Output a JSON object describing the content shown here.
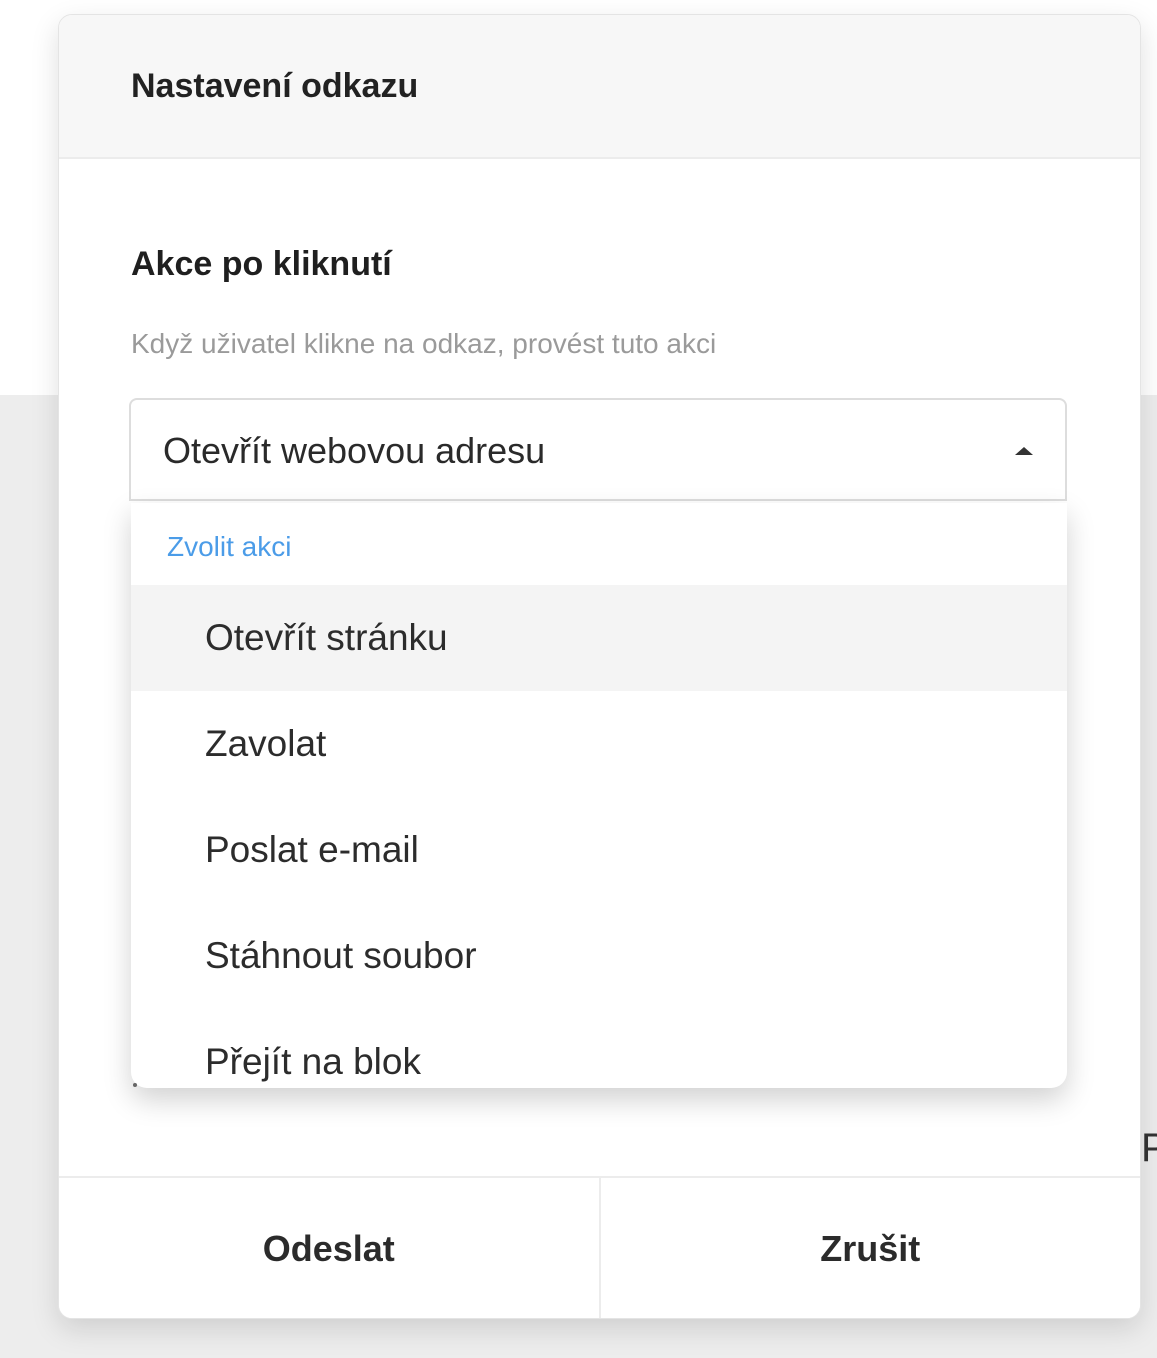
{
  "modal": {
    "title": "Nastavení odkazu",
    "section_label": "Akce po kliknutí",
    "section_help": "Když uživatel klikne na odkaz, provést tuto akci"
  },
  "select": {
    "selected_value": "Otevřít webovou adresu",
    "caret_icon": "caret-up-icon"
  },
  "dropdown": {
    "group_label": "Zvolit akci",
    "items": [
      {
        "label": "Otevřít stránku",
        "active": true
      },
      {
        "label": "Zavolat",
        "active": false
      },
      {
        "label": "Poslat e-mail",
        "active": false
      },
      {
        "label": "Stáhnout soubor",
        "active": false
      },
      {
        "label": "Přejít na blok",
        "active": false
      }
    ]
  },
  "footer": {
    "submit_label": "Odeslat",
    "cancel_label": "Zrušit"
  },
  "backdrop": {
    "visible_fragment": "P"
  },
  "colors": {
    "accent_blue": "#4b9ce8",
    "header_bg": "#f7f7f7",
    "backdrop_bg": "#ededed"
  }
}
